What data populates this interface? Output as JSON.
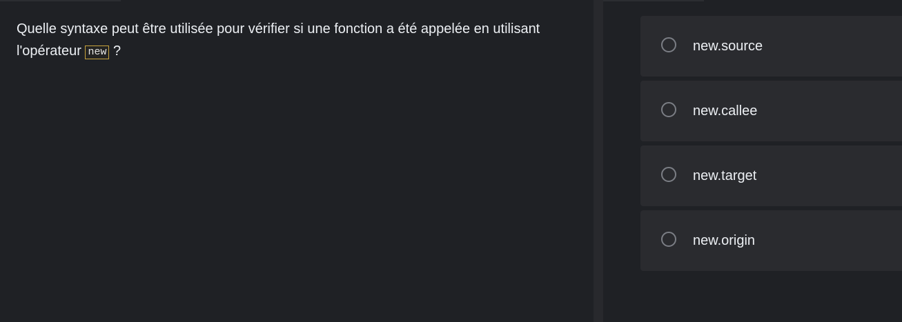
{
  "question": {
    "text_before": "Quelle syntaxe peut être utilisée pour vérifier si une fonction a été appelée en utilisant l'opérateur",
    "code": "new",
    "text_after": "?"
  },
  "options": [
    {
      "label": "new.source",
      "selected": false
    },
    {
      "label": "new.callee",
      "selected": false
    },
    {
      "label": "new.target",
      "selected": false
    },
    {
      "label": "new.origin",
      "selected": false
    }
  ],
  "colors": {
    "background": "#1f2125",
    "option_background": "#2a2b2f",
    "code_border": "#c9a43e",
    "text": "#eceff3"
  }
}
